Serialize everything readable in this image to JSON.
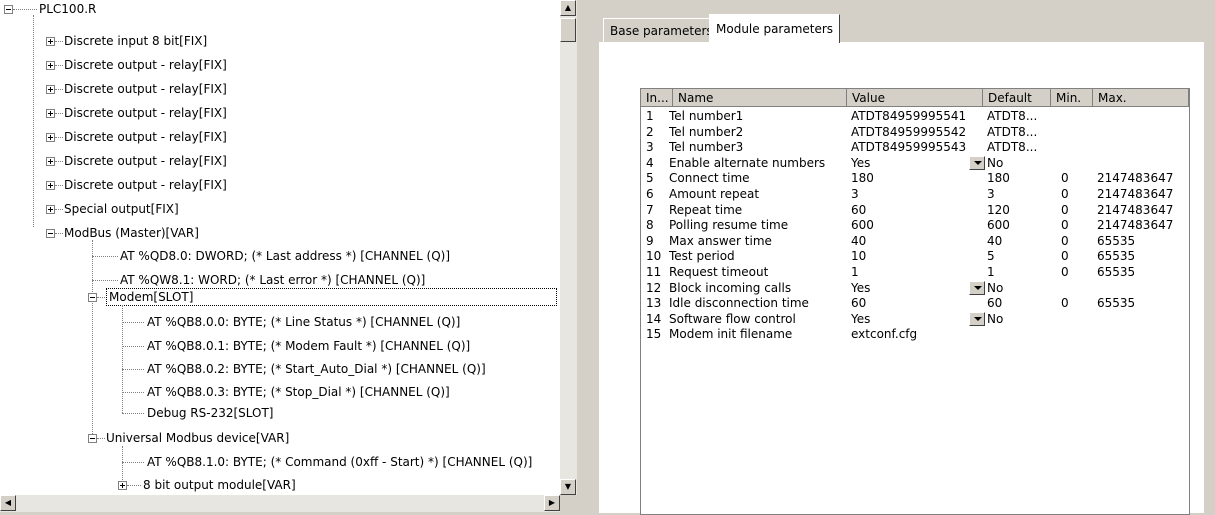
{
  "tree": {
    "root": "PLC100.R",
    "modules": [
      "Discrete input 8 bit[FIX]",
      "Discrete output - relay[FIX]",
      "Discrete output - relay[FIX]",
      "Discrete output - relay[FIX]",
      "Discrete output - relay[FIX]",
      "Discrete output - relay[FIX]",
      "Discrete output - relay[FIX]",
      "Special output[FIX]",
      "ModBus (Master)[VAR]"
    ],
    "modbus_children": [
      "AT %QD8.0: DWORD; (* Last address *) [CHANNEL (Q)]",
      "AT %QW8.1: WORD; (* Last error *) [CHANNEL (Q)]"
    ],
    "modem": "Modem[SLOT]",
    "modem_children": [
      "AT %QB8.0.0: BYTE; (* Line Status *) [CHANNEL (Q)]",
      "AT %QB8.0.1: BYTE; (* Modem Fault *) [CHANNEL (Q)]",
      "AT %QB8.0.2: BYTE; (* Start_Auto_Dial *) [CHANNEL (Q)]",
      "AT %QB8.0.3: BYTE; (* Stop_Dial *) [CHANNEL (Q)]",
      "Debug RS-232[SLOT]"
    ],
    "universal": "Universal Modbus device[VAR]",
    "universal_children": [
      "AT %QB8.1.0: BYTE; (* Command (0xff - Start) *) [CHANNEL (Q)]",
      "8 bit output module[VAR]"
    ]
  },
  "tabs": [
    "Base parameters",
    "Module parameters"
  ],
  "grid": {
    "headers": [
      "In...",
      "Name",
      "Value",
      "Default",
      "Min.",
      "Max."
    ],
    "rows": [
      {
        "index": "1",
        "name": "Tel number1",
        "value": "ATDT84959995541",
        "default": "ATDT8...",
        "min": "",
        "max": ""
      },
      {
        "index": "2",
        "name": "Tel number2",
        "value": "ATDT84959995542",
        "default": "ATDT8...",
        "min": "",
        "max": ""
      },
      {
        "index": "3",
        "name": "Tel number3",
        "value": "ATDT84959995543",
        "default": "ATDT8...",
        "min": "",
        "max": ""
      },
      {
        "index": "4",
        "name": "Enable alternate numbers",
        "value": "Yes",
        "default": "No",
        "min": "",
        "max": ""
      },
      {
        "index": "5",
        "name": "Connect time",
        "value": "180",
        "default": "180",
        "min": "0",
        "max": "2147483647"
      },
      {
        "index": "6",
        "name": "Amount repeat",
        "value": "3",
        "default": "3",
        "min": "0",
        "max": "2147483647"
      },
      {
        "index": "7",
        "name": "Repeat time",
        "value": "60",
        "default": "120",
        "min": "0",
        "max": "2147483647"
      },
      {
        "index": "8",
        "name": "Polling resume time",
        "value": "600",
        "default": "600",
        "min": "0",
        "max": "2147483647"
      },
      {
        "index": "9",
        "name": "Max answer time",
        "value": "40",
        "default": "40",
        "min": "0",
        "max": "65535"
      },
      {
        "index": "10",
        "name": "Test period",
        "value": "10",
        "default": "5",
        "min": "0",
        "max": "65535"
      },
      {
        "index": "11",
        "name": "Request timeout",
        "value": "1",
        "default": "1",
        "min": "0",
        "max": "65535"
      },
      {
        "index": "12",
        "name": "Block incoming calls",
        "value": "Yes",
        "default": "No",
        "min": "",
        "max": ""
      },
      {
        "index": "13",
        "name": "Idle disconnection time",
        "value": "60",
        "default": "60",
        "min": "0",
        "max": "65535"
      },
      {
        "index": "14",
        "name": "Software flow control",
        "value": "Yes",
        "default": "No",
        "min": "",
        "max": ""
      },
      {
        "index": "15",
        "name": "Modem init filename",
        "value": "extconf.cfg",
        "default": "",
        "min": "",
        "max": ""
      }
    ],
    "dropdown_rows": [
      3,
      11,
      13
    ]
  }
}
